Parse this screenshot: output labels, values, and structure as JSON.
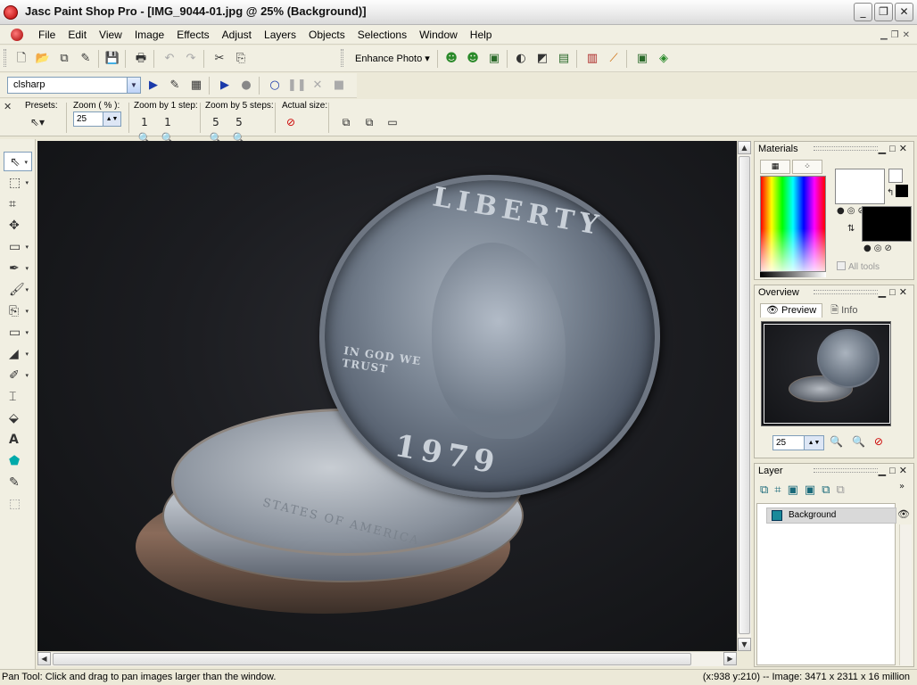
{
  "window": {
    "title": "Jasc Paint Shop Pro - [IMG_9044-01.jpg @  25% (Background)]",
    "controls": [
      "_",
      "❐",
      "✕"
    ]
  },
  "menu": {
    "items": [
      "File",
      "Edit",
      "View",
      "Image",
      "Effects",
      "Adjust",
      "Layers",
      "Objects",
      "Selections",
      "Window",
      "Help"
    ]
  },
  "toolbar": {
    "enhance_photo": "Enhance Photo ▾"
  },
  "script": {
    "selected": "clsharp"
  },
  "tool_options": {
    "presets_label": "Presets:",
    "zoom_label": "Zoom ( % ):",
    "zoom_value": "25",
    "zoom1_label": "Zoom by 1 step:",
    "zoom5_label": "Zoom by 5 steps:",
    "actual_label": "Actual size:"
  },
  "canvas": {
    "coin_liberty": "LIBERTY",
    "coin_year": "1979",
    "coin_motto": "IN GOD WE\nTRUST",
    "stack_text": "STATES OF AMERICA"
  },
  "palettes": {
    "materials": {
      "title": "Materials",
      "all_tools": "All tools"
    },
    "overview": {
      "title": "Overview",
      "tab_preview": "Preview",
      "tab_info": "Info",
      "zoom_value": "25"
    },
    "layer": {
      "title": "Layer",
      "layer_name": "Background"
    }
  },
  "status": {
    "left": "Pan Tool: Click and drag to pan images larger than the window.",
    "right": "(x:938 y:210) -- Image:  3471 x 2311 x 16 million"
  },
  "colors": {
    "foreground": "#FFFFFF",
    "background": "#000000",
    "accent": "#316AC5"
  }
}
